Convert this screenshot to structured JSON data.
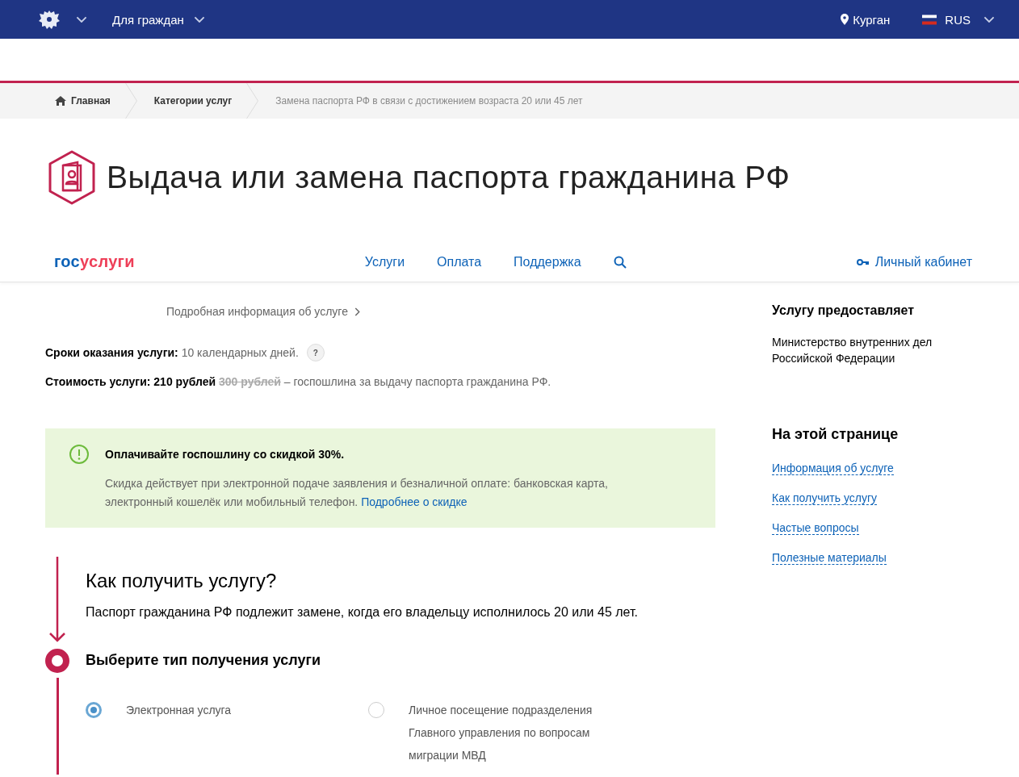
{
  "top_bar": {
    "section": "Для граждан",
    "city": "Курган",
    "language": "RUS"
  },
  "breadcrumbs": [
    {
      "label": "Главная",
      "kind": "home"
    },
    {
      "label": "Категории услуг",
      "kind": "link"
    },
    {
      "label": "Замена паспорта РФ в связи с достижением возраста 20 или 45 лет",
      "kind": "current"
    }
  ],
  "page_title": "Выдача или замена паспорта гражданина РФ",
  "nav": {
    "logo": {
      "prefix": "гос",
      "suffix": "услуги"
    },
    "links": [
      "Услуги",
      "Оплата",
      "Поддержка"
    ],
    "account": "Личный кабинет"
  },
  "details_link": "Подробная информация об услуге",
  "term": {
    "label": "Сроки оказания услуги:",
    "value": "10 календарных дней.",
    "help": "?"
  },
  "cost": {
    "label": "Стоимость услуги:",
    "value": "210 рублей",
    "old_value": "300 рублей",
    "note": "– госпошлина за выдачу паспорта гражданина РФ."
  },
  "notice": {
    "title": "Оплачивайте госпошлину со скидкой 30%.",
    "text": "Скидка действует при электронной подаче заявления и безналичной оплате: банковская карта, электронный кошелёк или мобильный телефон.",
    "link": "Подробнее о скидке"
  },
  "how_to": {
    "title": "Как получить услугу?",
    "text": "Паспорт гражданина РФ подлежит замене, когда его владельцу исполнилось 20 или 45 лет.",
    "step_title": "Выберите тип получения услуги",
    "options": [
      {
        "label": "Электронная услуга",
        "selected": true
      },
      {
        "label": "Личное посещение подразделения Главного управления по вопросам миграции МВД",
        "selected": false
      }
    ]
  },
  "provider": {
    "title": "Услугу предоставляет",
    "text": "Министерство внутренних дел Российской Федерации"
  },
  "on_page": {
    "title": "На этой странице",
    "links": [
      "Информация об услуге",
      "Как получить услугу",
      "Частые вопросы",
      "Полезные материалы"
    ]
  }
}
